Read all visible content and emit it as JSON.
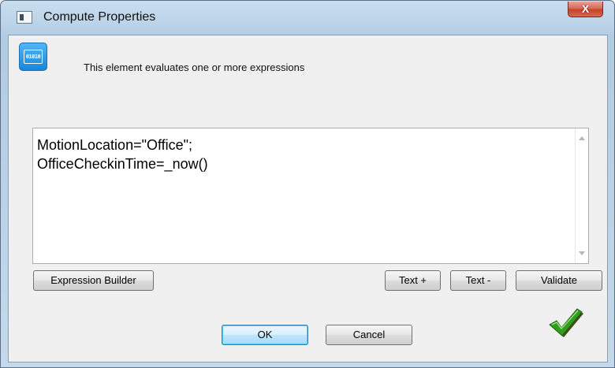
{
  "window": {
    "title": "Compute Properties",
    "close_label": "X"
  },
  "header": {
    "icon": "binary-data-icon",
    "icon_text": "01010",
    "description": "This element evaluates one or more expressions"
  },
  "editor": {
    "value": "MotionLocation=\"Office\";\nOfficeCheckinTime=_now()"
  },
  "toolbar": {
    "expression_builder_label": "Expression Builder",
    "text_plus_label": "Text +",
    "text_minus_label": "Text -",
    "validate_label": "Validate"
  },
  "footer": {
    "ok_label": "OK",
    "cancel_label": "Cancel",
    "status_icon": "checkmark-icon"
  },
  "colors": {
    "accent": "#1b86d8",
    "check_green": "#2e9e1c"
  }
}
